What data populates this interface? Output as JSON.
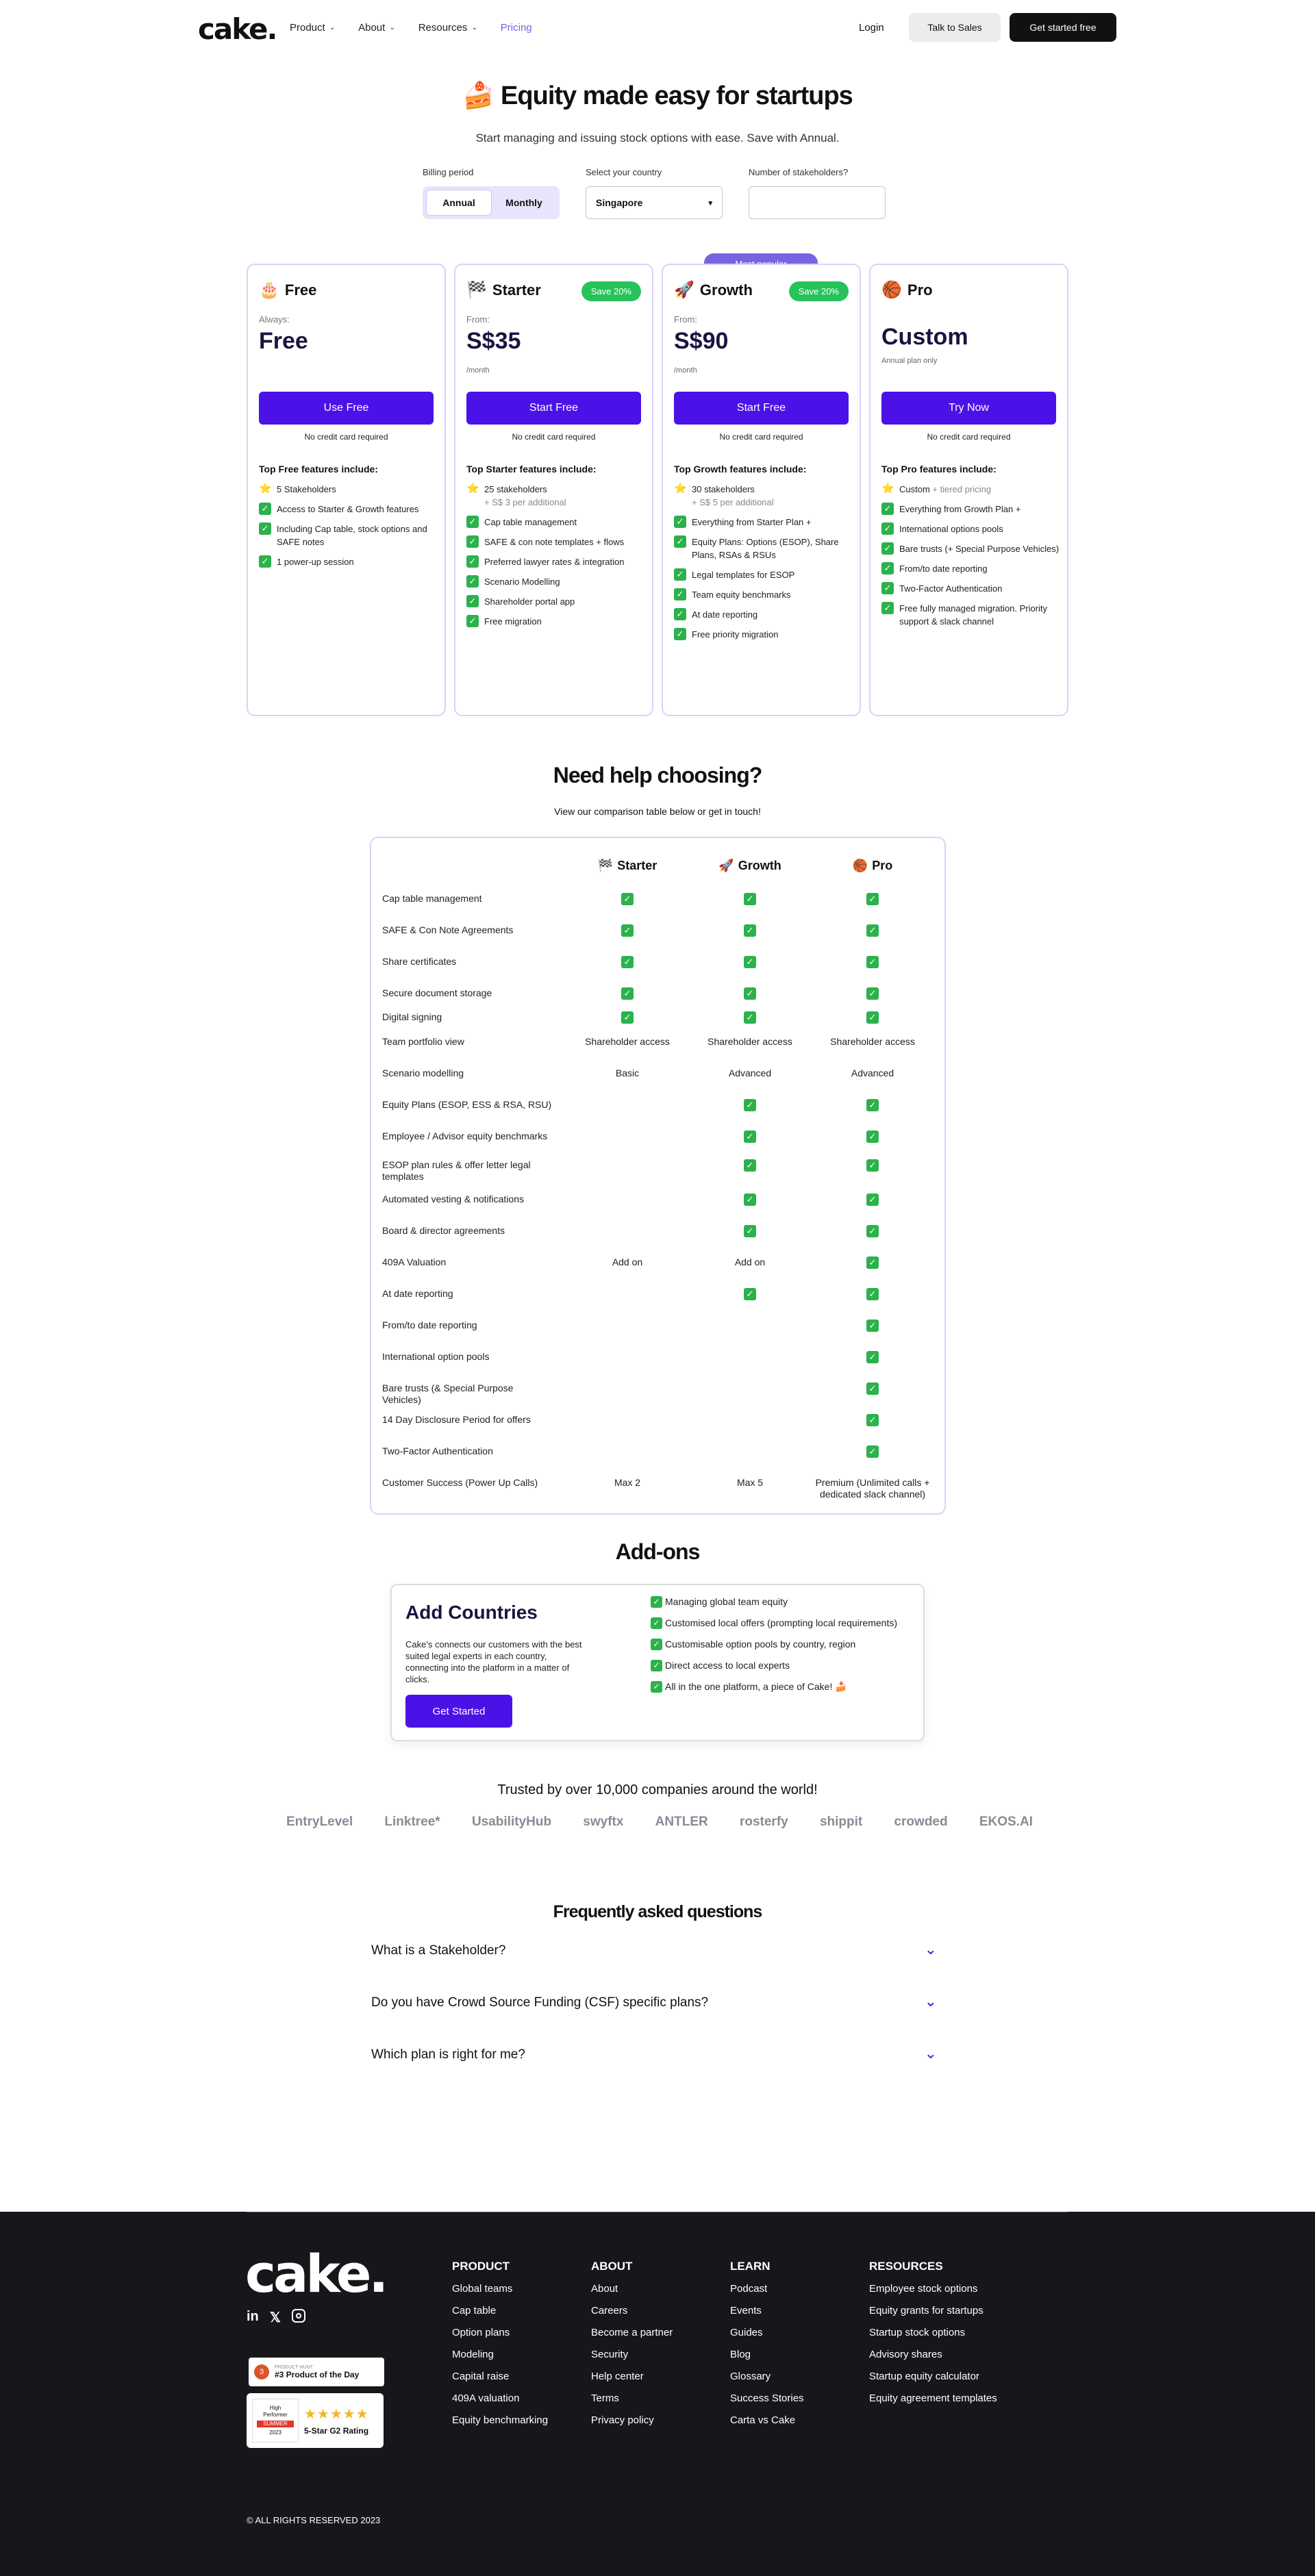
{
  "nav": {
    "logo": "cake.",
    "links": [
      {
        "label": "Product",
        "dropdown": true
      },
      {
        "label": "About",
        "dropdown": true
      },
      {
        "label": "Resources",
        "dropdown": true
      },
      {
        "label": "Pricing",
        "dropdown": false,
        "active": true
      }
    ],
    "login": "Login",
    "talk_to_sales": "Talk to Sales",
    "get_started": "Get started free"
  },
  "hero": {
    "title": "🍰 Equity made easy for startups",
    "subtitle": "Start managing and issuing stock options with ease. Save with Annual."
  },
  "controls": {
    "billing_label": "Billing period",
    "billing_options": [
      "Annual",
      "Monthly"
    ],
    "billing_selected": "Annual",
    "country_label": "Select your country",
    "country_value": "Singapore",
    "stakeholders_label": "Number of stakeholders?",
    "stakeholders_value": ""
  },
  "popular_badge": "Most popular",
  "plans": [
    {
      "emoji": "🎂",
      "name": "Free",
      "save": "",
      "from": "Always:",
      "price": "Free",
      "per": "",
      "cta": "Use Free",
      "no_cc": "No credit card required",
      "features_title": "Top Free features include:",
      "features": [
        {
          "icon": "star",
          "text": "5 Stakeholders",
          "sub": ""
        },
        {
          "icon": "check",
          "text": "Access to Starter & Growth features",
          "sub": ""
        },
        {
          "icon": "check",
          "text": "Including Cap table, stock options and SAFE notes",
          "sub": ""
        },
        {
          "icon": "check",
          "text": "1 power-up session",
          "sub": ""
        }
      ]
    },
    {
      "emoji": "🏁",
      "name": "Starter",
      "save": "Save 20%",
      "from": "From:",
      "price": "S$35",
      "per": "/month",
      "cta": "Start Free",
      "no_cc": "No credit card required",
      "features_title": "Top Starter features include:",
      "features": [
        {
          "icon": "star",
          "text": "25 stakeholders",
          "sub": "+ S$ 3 per additional"
        },
        {
          "icon": "check",
          "text": "Cap table management",
          "sub": ""
        },
        {
          "icon": "check",
          "text": "SAFE & con note templates + flows",
          "sub": ""
        },
        {
          "icon": "check",
          "text": "Preferred lawyer rates & integration",
          "sub": ""
        },
        {
          "icon": "check",
          "text": "Scenario Modelling",
          "sub": ""
        },
        {
          "icon": "check",
          "text": "Shareholder portal app",
          "sub": ""
        },
        {
          "icon": "check",
          "text": "Free migration",
          "sub": ""
        }
      ]
    },
    {
      "emoji": "🚀",
      "name": "Growth",
      "save": "Save 20%",
      "from": "From:",
      "price": "S$90",
      "per": "/month",
      "cta": "Start Free",
      "no_cc": "No credit card required",
      "features_title": "Top Growth features include:",
      "features": [
        {
          "icon": "star",
          "text": "30 stakeholders",
          "sub": "+ S$ 5 per additional"
        },
        {
          "icon": "check",
          "text": "Everything from Starter Plan +",
          "sub": ""
        },
        {
          "icon": "check",
          "text": "Equity Plans: Options (ESOP), Share Plans, RSAs & RSUs",
          "sub": ""
        },
        {
          "icon": "check",
          "text": "Legal templates for ESOP",
          "sub": ""
        },
        {
          "icon": "check",
          "text": "Team equity benchmarks",
          "sub": ""
        },
        {
          "icon": "check",
          "text": "At date reporting",
          "sub": ""
        },
        {
          "icon": "check",
          "text": "Free priority migration",
          "sub": ""
        }
      ]
    },
    {
      "emoji": "🏀",
      "name": "Pro",
      "save": "",
      "from": "",
      "price": "Custom",
      "per": "Annual plan only",
      "cta": "Try Now",
      "no_cc": "No credit card required",
      "features_title": "Top Pro features include:",
      "features": [
        {
          "icon": "star",
          "text": "Custom",
          "sub": "+ tiered pricing"
        },
        {
          "icon": "check",
          "text": "Everything from Growth Plan +",
          "sub": ""
        },
        {
          "icon": "check",
          "text": "International options pools",
          "sub": ""
        },
        {
          "icon": "check",
          "text": "Bare trusts (+ Special Purpose Vehicles)",
          "sub": ""
        },
        {
          "icon": "check",
          "text": "From/to date reporting",
          "sub": ""
        },
        {
          "icon": "check",
          "text": "Two-Factor Authentication",
          "sub": ""
        },
        {
          "icon": "check",
          "text": "Free fully managed migration. Priority support & slack channel",
          "sub": ""
        }
      ]
    }
  ],
  "help": {
    "title": "Need help choosing?",
    "subtitle": "View our comparison table below or get in touch!"
  },
  "comparison": {
    "columns": [
      {
        "emoji": "🏁",
        "name": "Starter"
      },
      {
        "emoji": "🚀",
        "name": "Growth"
      },
      {
        "emoji": "🏀",
        "name": "Pro"
      }
    ],
    "rows": [
      {
        "feature": "Cap table management",
        "values": [
          "✓",
          "✓",
          "✓"
        ]
      },
      {
        "feature": "SAFE & Con Note Agreements",
        "values": [
          "✓",
          "✓",
          "✓"
        ]
      },
      {
        "feature": "Share certificates",
        "values": [
          "✓",
          "✓",
          "✓"
        ]
      },
      {
        "feature": "Secure document storage",
        "values": [
          "✓",
          "✓",
          "✓"
        ]
      },
      {
        "feature": "Digital signing",
        "values": [
          "✓",
          "✓",
          "✓"
        ]
      },
      {
        "feature": "Team portfolio view",
        "values": [
          "Shareholder access",
          "Shareholder access",
          "Shareholder access"
        ]
      },
      {
        "feature": "Scenario modelling",
        "values": [
          "Basic",
          "Advanced",
          "Advanced"
        ]
      },
      {
        "feature": "Equity Plans (ESOP, ESS & RSA, RSU)",
        "values": [
          "",
          "✓",
          "✓"
        ]
      },
      {
        "feature": "Employee / Advisor equity benchmarks",
        "values": [
          "",
          "✓",
          "✓"
        ]
      },
      {
        "feature": "ESOP plan rules & offer letter legal templates",
        "values": [
          "",
          "✓",
          "✓"
        ]
      },
      {
        "feature": "Automated vesting & notifications",
        "values": [
          "",
          "✓",
          "✓"
        ]
      },
      {
        "feature": "Board & director agreements",
        "values": [
          "",
          "✓",
          "✓"
        ]
      },
      {
        "feature": "409A Valuation",
        "values": [
          "Add on",
          "Add on",
          "✓"
        ]
      },
      {
        "feature": "At date reporting",
        "values": [
          "",
          "✓",
          "✓"
        ]
      },
      {
        "feature": "From/to date reporting",
        "values": [
          "",
          "",
          "✓"
        ]
      },
      {
        "feature": "International option pools",
        "values": [
          "",
          "",
          "✓"
        ]
      },
      {
        "feature": "Bare trusts (& Special Purpose Vehicles)",
        "values": [
          "",
          "",
          "✓"
        ]
      },
      {
        "feature": "14 Day Disclosure Period for offers",
        "values": [
          "",
          "",
          "✓"
        ]
      },
      {
        "feature": "Two-Factor Authentication",
        "values": [
          "",
          "",
          "✓"
        ]
      },
      {
        "feature": "Customer Success (Power Up Calls)",
        "values": [
          "Max 2",
          "Max 5",
          "Premium (Unlimited calls + dedicated slack channel)"
        ]
      }
    ]
  },
  "addons": {
    "title": "Add-ons",
    "card_title": "Add Countries",
    "description": "Cake's connects our customers with the best suited legal experts in each country, connecting into the platform in a matter of clicks.",
    "cta": "Get Started",
    "features": [
      "Managing global team equity",
      "Customised local offers (prompting local requirements)",
      "Customisable option pools by country, region",
      "Direct access to local experts",
      "All in the one platform, a piece of Cake! 🍰"
    ]
  },
  "trusted": {
    "text": "Trusted by over 10,000 companies around the world!",
    "logos": [
      "EntryLevel",
      "Linktree*",
      "UsabilityHub",
      "swyftx",
      "ANTLER",
      "rosterfy",
      "shippit",
      "crowded",
      "EKOS.AI"
    ]
  },
  "faq": {
    "title": "Frequently asked questions",
    "items": [
      "What is a Stakeholder?",
      "Do you have Crowd Source Funding (CSF) specific plans?",
      "Which plan is right for me?"
    ]
  },
  "footer": {
    "logo": "cake.",
    "social": [
      "linkedin-icon",
      "x-icon",
      "instagram-icon"
    ],
    "badge_ph_small": "PRODUCT HUNT",
    "badge_ph": "#3 Product of the Day",
    "badge_g2_lines": [
      "High",
      "Performer",
      "SUMMER",
      "2023"
    ],
    "badge_g2_rating": "5-Star G2 Rating",
    "columns": [
      {
        "heading": "PRODUCT",
        "links": [
          "Global teams",
          "Cap table",
          "Option plans",
          "Modeling",
          "Capital raise",
          "409A valuation",
          "Equity benchmarking"
        ]
      },
      {
        "heading": "ABOUT",
        "links": [
          "About",
          "Careers",
          "Become a partner",
          "Security",
          "Help center",
          "Terms",
          "Privacy policy"
        ]
      },
      {
        "heading": "LEARN",
        "links": [
          "Podcast",
          "Events",
          "Guides",
          "Blog",
          "Glossary",
          "Success Stories",
          "Carta vs Cake"
        ]
      },
      {
        "heading": "RESOURCES",
        "links": [
          "Employee stock options",
          "Equity grants for startups",
          "Startup stock options",
          "Advisory shares",
          "Startup equity calculator",
          "Equity agreement templates"
        ]
      }
    ],
    "copyright": "© ALL RIGHTS RESERVED 2023"
  }
}
